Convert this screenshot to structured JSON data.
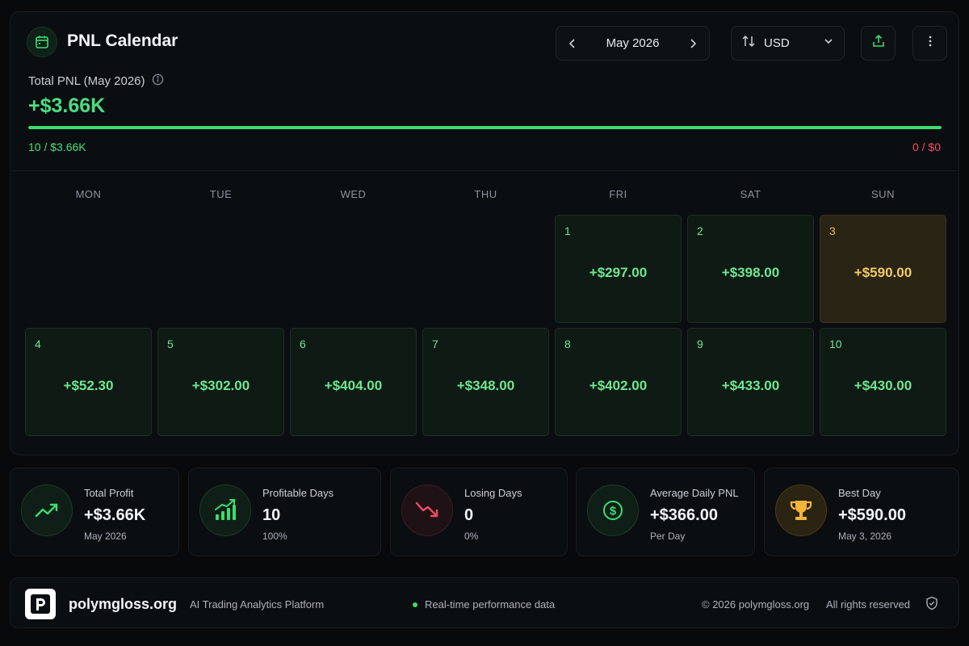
{
  "header": {
    "title": "PNL Calendar",
    "month_label": "May 2026",
    "currency_label": "USD",
    "icons": [
      "calendar-icon",
      "chevron-left-icon",
      "chevron-right-icon",
      "sort-arrows-icon",
      "chevron-down-icon",
      "export-icon",
      "more-vertical-icon"
    ]
  },
  "summary": {
    "total_label": "Total PNL (May 2026)",
    "total_value": "+$3.66K",
    "profit_fraction": 1.0,
    "win_text": "10 / $3.66K",
    "loss_text": "0 / $0",
    "colors": {
      "profit": "#4ade80",
      "loss": "#f04e63",
      "best": "#f4cb63"
    }
  },
  "calendar": {
    "weekdays": [
      "MON",
      "TUE",
      "WED",
      "THU",
      "FRI",
      "SAT",
      "SUN"
    ],
    "days": [
      {
        "day": "1",
        "amount": "+$297.00",
        "col": 4,
        "row": 0,
        "best": false
      },
      {
        "day": "2",
        "amount": "+$398.00",
        "col": 5,
        "row": 0,
        "best": false
      },
      {
        "day": "3",
        "amount": "+$590.00",
        "col": 6,
        "row": 0,
        "best": true
      },
      {
        "day": "4",
        "amount": "+$52.30",
        "col": 0,
        "row": 1,
        "best": false
      },
      {
        "day": "5",
        "amount": "+$302.00",
        "col": 1,
        "row": 1,
        "best": false
      },
      {
        "day": "6",
        "amount": "+$404.00",
        "col": 2,
        "row": 1,
        "best": false
      },
      {
        "day": "7",
        "amount": "+$348.00",
        "col": 3,
        "row": 1,
        "best": false
      },
      {
        "day": "8",
        "amount": "+$402.00",
        "col": 4,
        "row": 1,
        "best": false
      },
      {
        "day": "9",
        "amount": "+$433.00",
        "col": 5,
        "row": 1,
        "best": false
      },
      {
        "day": "10",
        "amount": "+$430.00",
        "col": 6,
        "row": 1,
        "best": false
      }
    ]
  },
  "stats": [
    {
      "label": "Total Profit",
      "value": "+$3.66K",
      "sub": "May 2026",
      "icon": "trending-up-icon"
    },
    {
      "label": "Profitable Days",
      "value": "10",
      "sub": "100%",
      "icon": "bar-chart-up-icon"
    },
    {
      "label": "Losing Days",
      "value": "0",
      "sub": "0%",
      "icon": "trending-down-icon"
    },
    {
      "label": "Average Daily PNL",
      "value": "+$366.00",
      "sub": "Per Day",
      "icon": "dollar-coin-icon"
    },
    {
      "label": "Best Day",
      "value": "+$590.00",
      "sub": "May 3, 2026",
      "icon": "trophy-icon"
    }
  ],
  "footer": {
    "logo_letter": "P",
    "brand": "polymgloss.org",
    "tagline": "AI Trading Analytics Platform",
    "realtime": "Real-time performance data",
    "copyright": "© 2026 polymgloss.org",
    "rights": "All rights reserved"
  }
}
